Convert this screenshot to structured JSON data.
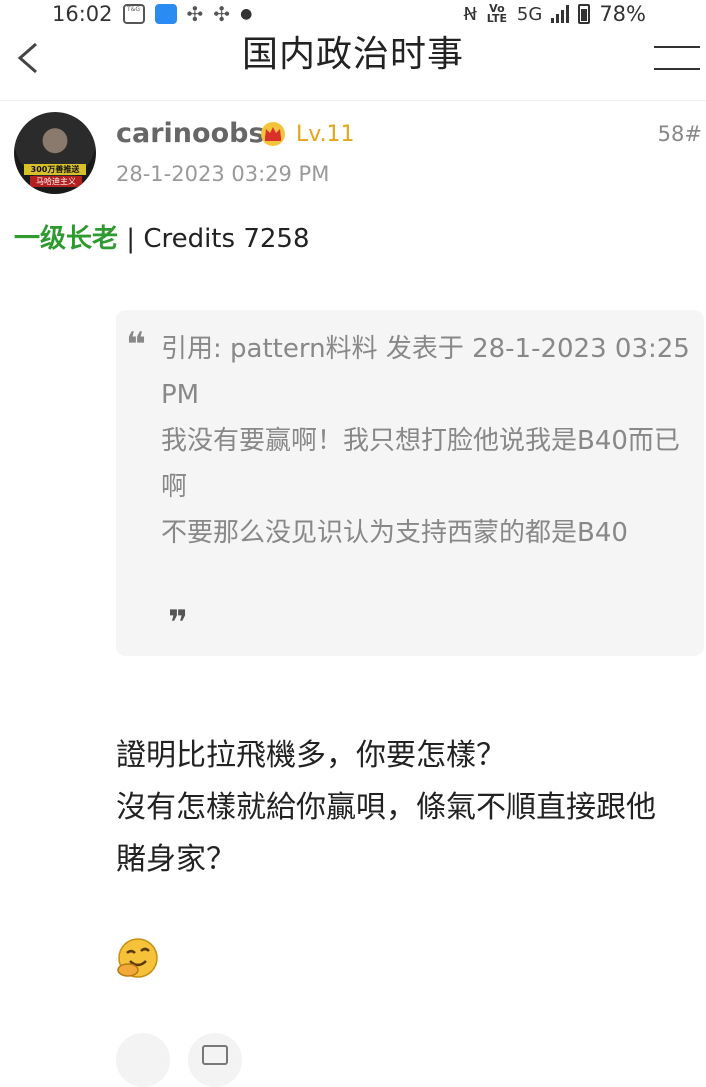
{
  "status_bar": {
    "time": "16:02",
    "network": "5G",
    "volte": "Vo LTE",
    "battery": "78%",
    "icons": [
      "touch-n-go-icon",
      "cloud-app-icon",
      "fan-icon",
      "fan-icon",
      "notification-dot",
      "nfc-icon",
      "volte-icon",
      "signal-icon",
      "battery-icon"
    ]
  },
  "nav": {
    "title": "国内政治时事",
    "back_icon": "chevron-left-icon",
    "menu_icon": "menu-icon"
  },
  "post": {
    "author": "carinoobs",
    "level": "Lv.11",
    "floor": "58#",
    "date": "28-1-2023 03:29 PM",
    "rank_title": "一级长老",
    "rank_separator": " | ",
    "credits": "Credits 7258",
    "avatar_caption_1": "300万善推送",
    "avatar_caption_2": "马哈迪主义",
    "quote": {
      "open_mark": "❝",
      "close_mark": "❞",
      "lines": [
        "引用: pattern料料 发表于 28-1-2023 03:25 PM",
        "我没有要赢啊！我只想打脸他说我是B40而已啊",
        "不要那么没见识认为支持西蒙的都是B40"
      ]
    },
    "body_lines": [
      "證明比拉飛機多，你要怎樣？",
      "沒有怎樣就給你贏唄，條氣不順直接跟他",
      "賭身家？"
    ],
    "emoji": "hand-over-mouth-laughing-emoji"
  },
  "colors": {
    "level": "#e3a617",
    "rank_title": "#2f9a2f",
    "quote_bg": "#f5f5f5",
    "muted_text": "#999999"
  }
}
